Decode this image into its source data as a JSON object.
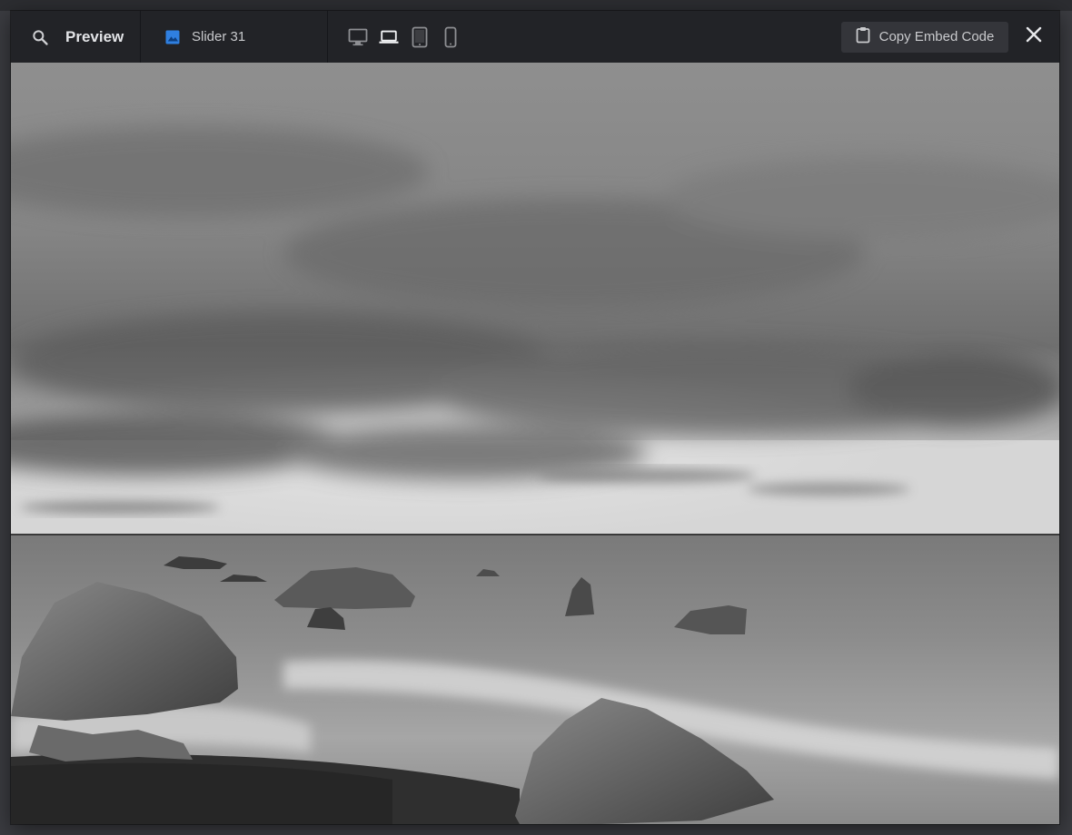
{
  "toolbar": {
    "preview_label": "Preview",
    "slider_name": "Slider 31",
    "copy_embed_label": "Copy Embed Code",
    "devices": [
      "desktop-icon",
      "laptop-icon",
      "tablet-icon",
      "mobile-icon"
    ],
    "active_device": "laptop-icon",
    "colors": {
      "background": "#222327",
      "accent": "#2f7fe0",
      "text": "#d8d9dc"
    }
  },
  "slide": {
    "description": "Black and white seascape with rocks and cloudy sky"
  }
}
